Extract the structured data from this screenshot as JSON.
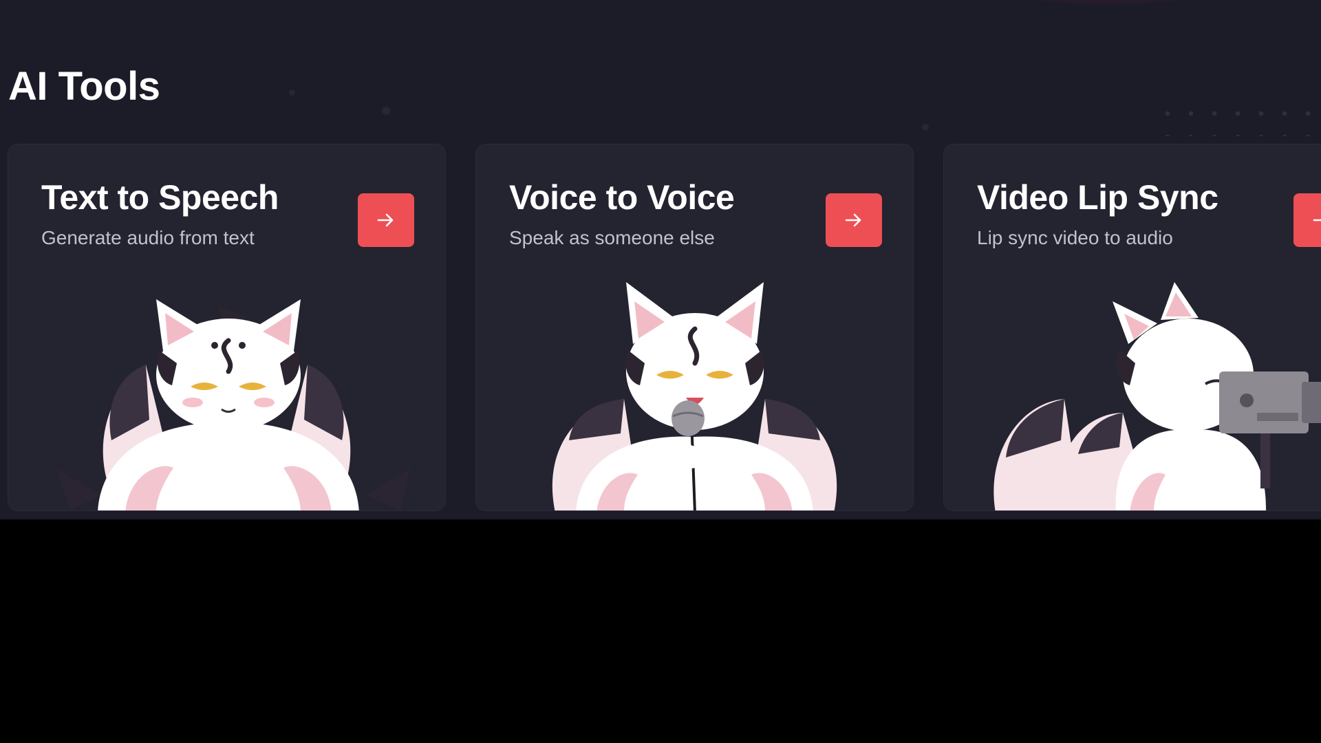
{
  "section": {
    "title": "AI Tools"
  },
  "colors": {
    "page_bg": "#1c1b28",
    "card_bg": "#242330",
    "accent": "#ee4f55",
    "subtext": "#c2c1cc",
    "letterbox": "#000000"
  },
  "tools": [
    {
      "title": "Text to Speech",
      "subtitle": "Generate audio from text",
      "button_icon": "arrow-right-icon",
      "illustration": "fox-mascot-sitting"
    },
    {
      "title": "Voice to Voice",
      "subtitle": "Speak as someone else",
      "button_icon": "arrow-right-icon",
      "illustration": "fox-mascot-microphone"
    },
    {
      "title": "Video Lip Sync",
      "subtitle": "Lip sync video to audio",
      "button_icon": "arrow-right-icon",
      "illustration": "fox-mascot-camera"
    }
  ]
}
